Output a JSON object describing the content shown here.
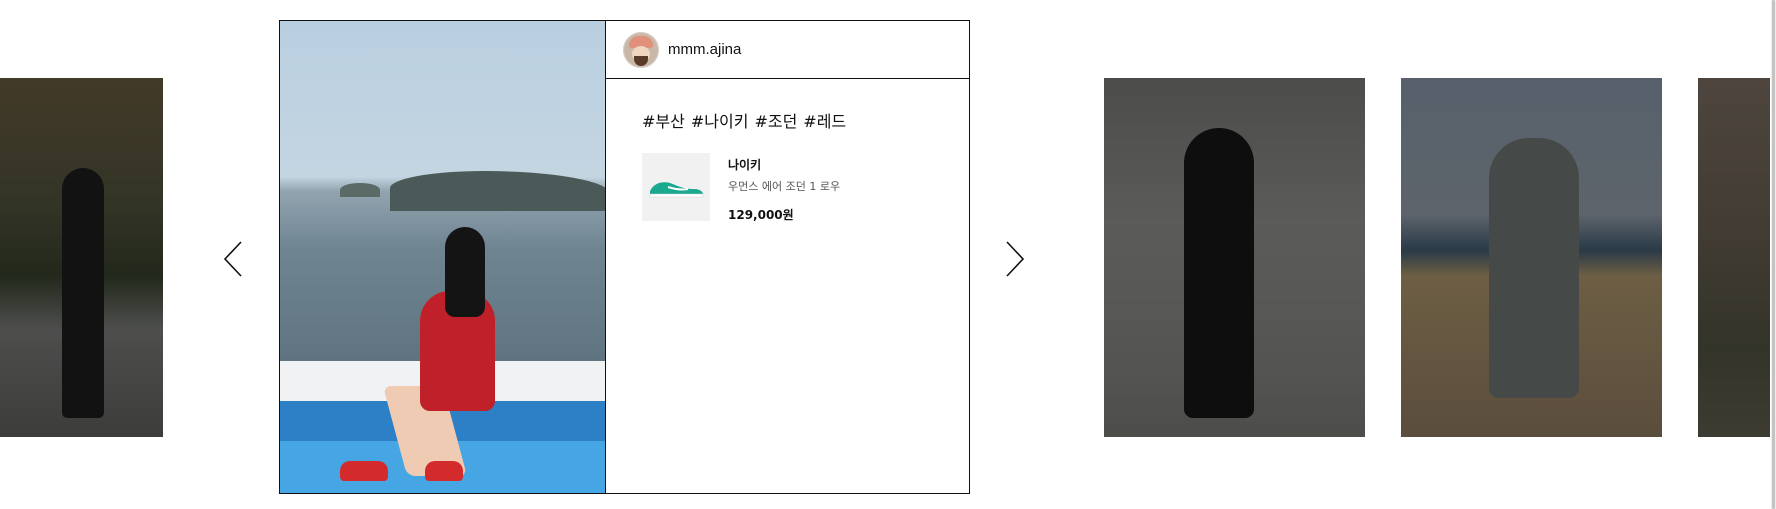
{
  "carousel": {
    "prev_icon": "chevron-left-icon",
    "next_icon": "chevron-right-icon"
  },
  "card": {
    "username": "mmm.ajina",
    "tags": [
      "#부산",
      "#나이키",
      "#조던",
      "#레드"
    ],
    "product": {
      "brand": "나이키",
      "name": "우먼스 에어 조던 1 로우",
      "price": "129,000원"
    }
  },
  "colors": {
    "border": "#111111",
    "background": "#ffffff",
    "dim_overlay": "rgba(0,0,0,0.45)",
    "sneaker_accent": "#1aa98f"
  }
}
